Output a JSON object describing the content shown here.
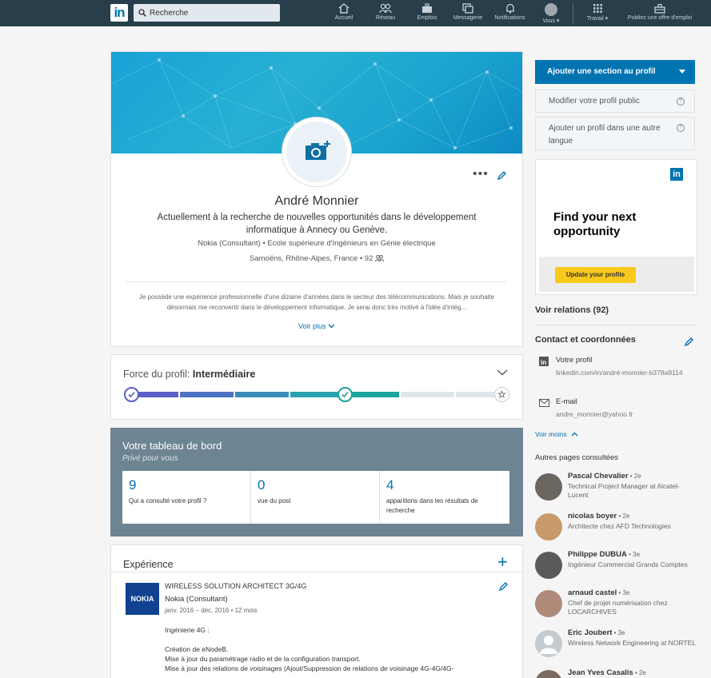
{
  "topbar": {
    "logo": "in",
    "search_placeholder": "Recherche",
    "nav": [
      {
        "label": "Accueil",
        "icon": "home-icon"
      },
      {
        "label": "Réseau",
        "icon": "network-icon"
      },
      {
        "label": "Emplois",
        "icon": "briefcase-icon"
      },
      {
        "label": "Messagerie",
        "icon": "messaging-icon"
      },
      {
        "label": "Notifications",
        "icon": "bell-icon"
      },
      {
        "label": "Vous ▾",
        "icon": "avatar"
      },
      {
        "label": "Travail ▾",
        "icon": "grid-icon"
      },
      {
        "label": "Publiez une offre d'emploi",
        "icon": "briefcase-post-icon"
      }
    ]
  },
  "profile": {
    "name": "André Monnier",
    "headline": "Actuellement à la recherche de nouvelles opportunités dans le développement informatique à Annecy ou Genève.",
    "company_line": "Nokia (Consultant) • Ecole supérieure d'Ingénieurs en Génie électrique",
    "location_line": "Samoëns, Rhône-Alpes, France • 92",
    "summary": "Je possède une expérience professionnelle d'une dizaine d'années dans le secteur des télécommunications. Mais je souhaite désormais me reconvertir dans le développement informatique. Je serai donc très motivé à l'idée d'intég...",
    "see_more": "Voir plus"
  },
  "strength": {
    "label": "Force du profil: ",
    "level": "Intermédiaire",
    "progress_steps_completed": 4,
    "progress_steps_total": 7
  },
  "dashboard": {
    "title": "Votre tableau de bord",
    "subtitle": "Privé pour vous",
    "stats": [
      {
        "num": "9",
        "label": "Qui a consulté votre profil ?"
      },
      {
        "num": "0",
        "label": "vue du post"
      },
      {
        "num": "4",
        "label": "apparitions dans les résultats de recherche"
      }
    ]
  },
  "experience": {
    "title": "Expérience",
    "items": [
      {
        "logo": "NOKIA",
        "role": "WIRELESS SOLUTION ARCHITECT 3G/4G",
        "company": "Nokia (Consultant)",
        "dates": "janv. 2016 – déc. 2016  •  12 mois",
        "desc_lines": [
          "Ingénierie 4G :",
          "",
          "Création de eNodeB.",
          "Mise à jour du paramétrage radio et de la configuration transport.",
          "Mise à jour des relations de voisinages (Ajout/Suppression de relations de voisinage 4G-4G/4G-"
        ]
      }
    ]
  },
  "sidebar": {
    "add_section": "Ajouter une section au profil",
    "public_profile": "Modifier votre profil public",
    "add_language": "Ajouter un profil dans une autre langue",
    "ad": {
      "logo": "in",
      "text": "Find your next opportunity",
      "button": "Update your profile"
    },
    "relations": "Voir relations (92)",
    "contact_title": "Contact et coordonnées",
    "contact": [
      {
        "label": "Votre profil",
        "value": "linkedin.com/in/andré-monnier-b378a9114",
        "icon": "linkedin-icon"
      },
      {
        "label": "E-mail",
        "value": "andre_monnier@yahoo.fr",
        "icon": "mail-icon"
      }
    ],
    "see_less": "Voir moins",
    "others_title": "Autres pages consultées",
    "people": [
      {
        "name": "Pascal Chevalier",
        "degree": " • 2e",
        "title": "Technical Project Manager at Alcatel-Lucent"
      },
      {
        "name": "nicolas boyer",
        "degree": " • 2e",
        "title": "Architecte chez AFD Technologies"
      },
      {
        "name": "Philippe DUBUA",
        "degree": " • 3e",
        "title": "Ingénieur Commercial Grands Comptes"
      },
      {
        "name": "arnaud castel",
        "degree": " • 3e",
        "title": "Chef de projet numérisation chez LOCARCHIVES"
      },
      {
        "name": "Eric Joubert",
        "degree": " • 3e",
        "title": "Wireless Network Engineering at NORTEL"
      },
      {
        "name": "Jean Yves Casalis",
        "degree": " • 2e",
        "title": ""
      }
    ]
  },
  "colors": {
    "topbar": "#283e4a",
    "accent": "#0073b1",
    "progress_complete": "#5b5fc7",
    "progress_teal": "#1aa59b",
    "progress_empty": "#dfe6ea"
  }
}
